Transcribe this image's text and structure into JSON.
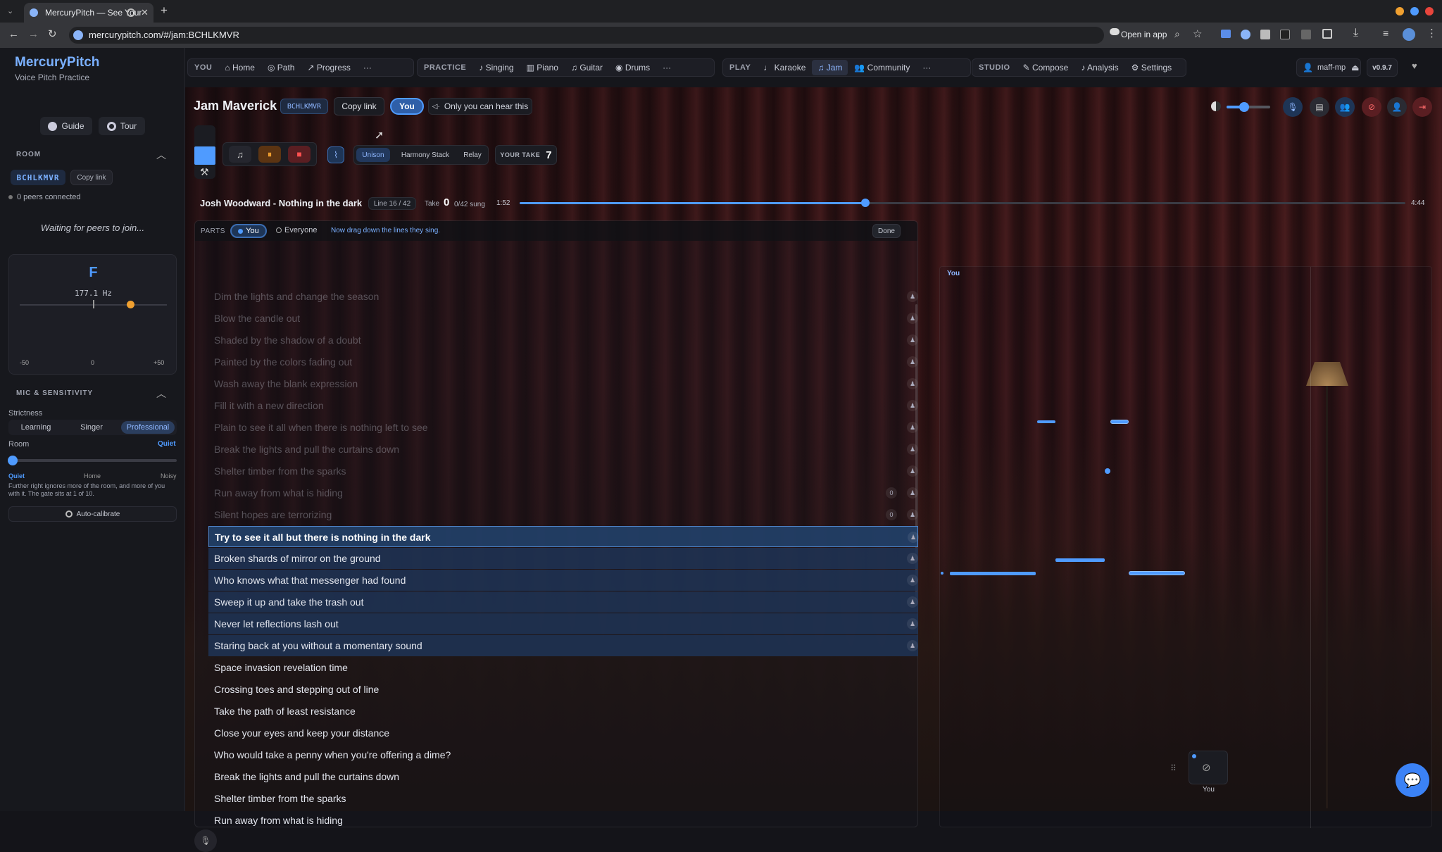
{
  "browser": {
    "tab_title": "MercuryPitch — See Your",
    "url": "mercurypitch.com/#/jam:BCHLKMVR",
    "open_in_app": "Open in app"
  },
  "brand": {
    "title": "MercuryPitch",
    "subtitle": "Voice Pitch Practice"
  },
  "nav": {
    "you_group": {
      "head": "YOU",
      "items": [
        "Home",
        "Path",
        "Progress"
      ]
    },
    "practice_group": {
      "head": "PRACTICE",
      "items": [
        "Singing",
        "Piano",
        "Guitar",
        "Drums"
      ]
    },
    "play_group": {
      "head": "PLAY",
      "items": [
        "Karaoke",
        "Jam",
        "Community"
      ],
      "active": "Jam"
    },
    "studio_group": {
      "head": "STUDIO",
      "items": [
        "Compose",
        "Analysis",
        "Settings"
      ]
    },
    "more": "···",
    "user": "maff-mp",
    "version": "v0.9.7"
  },
  "sidebar": {
    "guide": "Guide",
    "tour": "Tour",
    "room_section": "ROOM",
    "room_code": "BCHLKMVR",
    "copy_link": "Copy link",
    "peers": "0 peers connected",
    "waiting": "Waiting for peers to join...",
    "tuner": {
      "note": "F",
      "hz": "177.1 Hz",
      "min": "-50",
      "mid": "0",
      "max": "+50",
      "cents_fraction": 0.75
    },
    "mic_section": "MIC & SENSITIVITY",
    "strictness_label": "Strictness",
    "strictness_options": [
      "Learning",
      "Singer",
      "Professional"
    ],
    "strictness_selected": "Professional",
    "room_label": "Room",
    "room_value": "Quiet",
    "room_ticks": [
      "Quiet",
      "Home",
      "Noisy"
    ],
    "help": "Further right ignores more of the room, and more of you with it. The gate sits at 1 of 10.",
    "auto_calibrate": "Auto-calibrate"
  },
  "jam": {
    "title": "Jam Maverick",
    "code": "BCHLKMVR",
    "copy_link": "Copy link",
    "you": "You",
    "private_note": "Only you can hear this",
    "modes": [
      "Unison",
      "Harmony Stack",
      "Relay"
    ],
    "mode_selected": "Unison",
    "your_take_label": "YOUR TAKE",
    "your_take_value": "7",
    "song": "Josh Woodward - Nothing in the dark",
    "line_label": "Line 16 / 42",
    "take_label": "Take",
    "take_value": "0",
    "sung": "0/42 sung",
    "time_current": "1:52",
    "time_total": "4:44",
    "progress": 0.39
  },
  "parts": {
    "label": "PARTS",
    "you": "You",
    "everyone": "Everyone",
    "hint": "Now drag down the lines they sing.",
    "done": "Done"
  },
  "lyrics": [
    {
      "text": "Dim the lights and change the season",
      "state": "past"
    },
    {
      "text": "Blow the candle out",
      "state": "past"
    },
    {
      "text": "Shaded by the shadow of a doubt",
      "state": "past"
    },
    {
      "text": "Painted by the colors fading out",
      "state": "past"
    },
    {
      "text": "Wash away the blank expression",
      "state": "past"
    },
    {
      "text": "Fill it with a new direction",
      "state": "past"
    },
    {
      "text": "Plain to see it all when there is nothing left to see",
      "state": "past"
    },
    {
      "text": "Break the lights and pull the curtains down",
      "state": "past"
    },
    {
      "text": "Shelter timber from the sparks",
      "state": "past"
    },
    {
      "text": "Run away from what is hiding",
      "state": "past",
      "count": "0"
    },
    {
      "text": "Silent hopes are terrorizing",
      "state": "past",
      "count": "0"
    },
    {
      "text": "Try to see it all but there is nothing in the dark",
      "state": "current"
    },
    {
      "text": "Broken shards of mirror on the ground",
      "state": "sel"
    },
    {
      "text": "Who knows what that messenger had found",
      "state": "sel"
    },
    {
      "text": "Sweep it up and take the trash out",
      "state": "sel"
    },
    {
      "text": "Never let reflections lash out",
      "state": "sel"
    },
    {
      "text": "Staring back at you without a momentary sound",
      "state": "sel"
    },
    {
      "text": "Space invasion revelation time",
      "state": "future"
    },
    {
      "text": "Crossing toes and stepping out of line",
      "state": "future"
    },
    {
      "text": "Take the path of least resistance",
      "state": "future"
    },
    {
      "text": "Close your eyes and keep your distance",
      "state": "future"
    },
    {
      "text": "Who would take a penny when you're offering a dime?",
      "state": "future"
    },
    {
      "text": "Break the lights and pull the curtains down",
      "state": "future"
    },
    {
      "text": "Shelter timber from the sparks",
      "state": "future"
    },
    {
      "text": "Run away from what is hiding",
      "state": "future"
    }
  ],
  "pitch_panel": {
    "label": "You",
    "camera_label": "You"
  },
  "colors": {
    "accent": "#4f9bff",
    "orange": "#f0a030",
    "highlight": "#1f3a5c"
  }
}
